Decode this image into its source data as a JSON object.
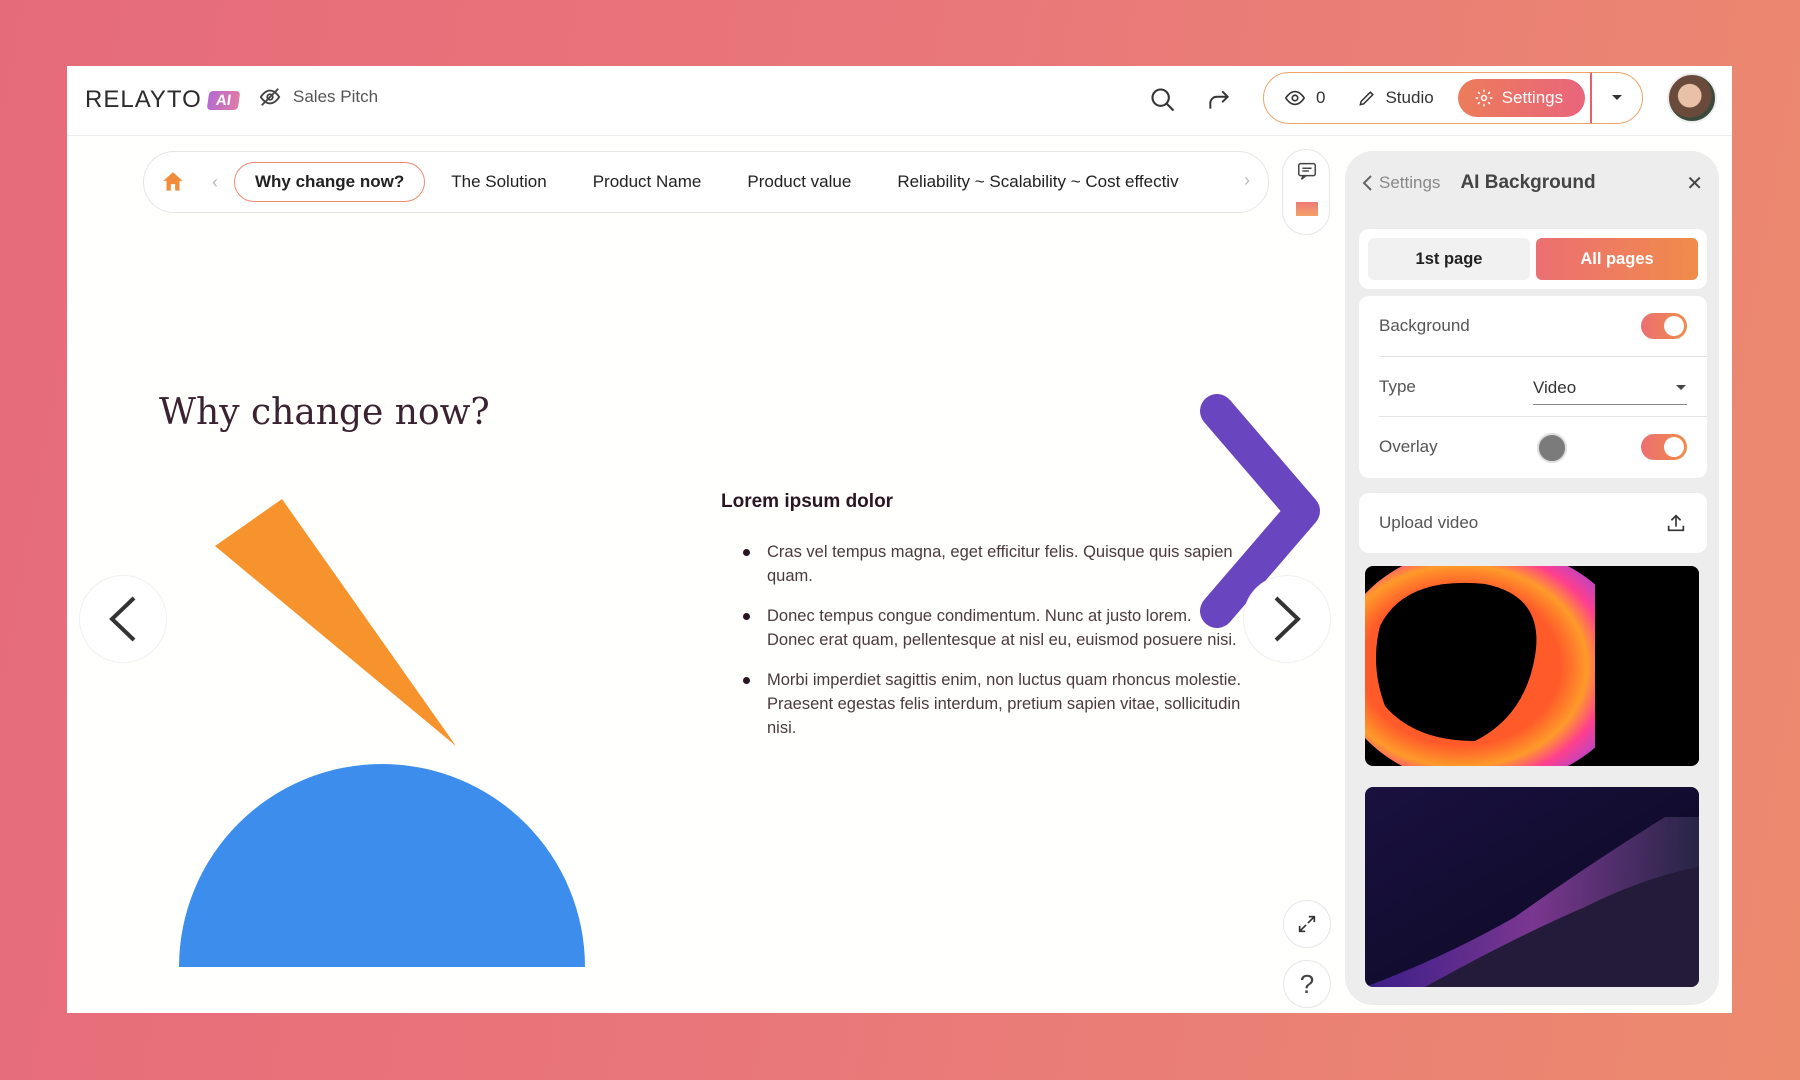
{
  "app": {
    "logo": "RELAYTO",
    "logo_badge": "AI",
    "deck_name": "Sales Pitch"
  },
  "toolbar": {
    "views": "0",
    "studio": "Studio",
    "settings": "Settings"
  },
  "tabs": [
    {
      "label": "Why change now?"
    },
    {
      "label": "The Solution"
    },
    {
      "label": "Product Name"
    },
    {
      "label": "Product value"
    },
    {
      "label": "Reliability ~ Scalability ~ Cost effectiv"
    }
  ],
  "slide": {
    "title": "Why change now?",
    "heading": "Lorem ipsum dolor",
    "bullets": [
      "Cras vel tempus magna, eget efficitur felis. Quisque quis sapien quam.",
      "Donec tempus congue condimentum. Nunc at justo lorem. Donec erat quam, pellentesque at nisl eu, euismod posuere nisi.",
      "Morbi imperdiet sagittis enim, non luctus quam rhoncus molestie. Praesent egestas felis interdum, pretium sapien vitae, sollicitudin nisi."
    ]
  },
  "panel": {
    "back": "Settings",
    "title": "AI Background",
    "seg_first": "1st page",
    "seg_all": "All pages",
    "background_label": "Background",
    "type_label": "Type",
    "type_value": "Video",
    "overlay_label": "Overlay",
    "upload_label": "Upload video"
  },
  "bottom": {
    "help": "?"
  },
  "colors": {
    "accent": "#ec7c5a",
    "brand_pink": "#e9657c",
    "slide_blue": "#3d8ded",
    "slide_orange": "#f7932d",
    "arrow_purple": "#5a3fc0"
  }
}
